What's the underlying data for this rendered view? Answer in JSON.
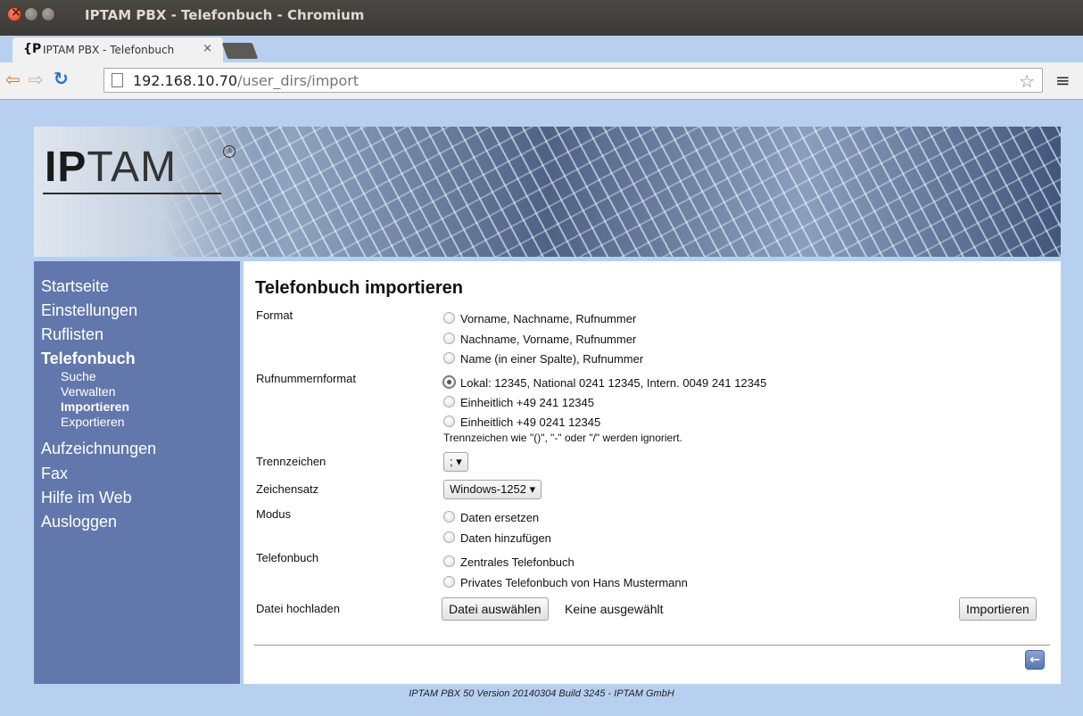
{
  "window": {
    "title": "IPTAM PBX - Telefonbuch - Chromium"
  },
  "tab": {
    "favicon": "{P",
    "title": "IPTAM PBX - Telefonbuch",
    "close": "×"
  },
  "toolbar": {
    "url_host": "192.168.10.70",
    "url_path": "/user_dirs/import"
  },
  "banner": {
    "logo_bold": "IP",
    "logo_light": "TAM",
    "logo_mark": "®"
  },
  "sidebar": {
    "items": [
      {
        "label": "Startseite"
      },
      {
        "label": "Einstellungen"
      },
      {
        "label": "Ruflisten"
      },
      {
        "label": "Telefonbuch"
      },
      {
        "label": "Aufzeichnungen"
      },
      {
        "label": "Fax"
      },
      {
        "label": "Hilfe im Web"
      },
      {
        "label": "Ausloggen"
      }
    ],
    "sub_items": [
      {
        "label": "Suche"
      },
      {
        "label": "Verwalten"
      },
      {
        "label": "Importieren"
      },
      {
        "label": "Exportieren"
      }
    ]
  },
  "form": {
    "title": "Telefonbuch importieren",
    "format": {
      "label": "Format",
      "options": [
        "Vorname, Nachname, Rufnummer",
        "Nachname, Vorname, Rufnummer",
        "Name (in einer Spalte), Rufnummer"
      ]
    },
    "number_format": {
      "label": "Rufnummernformat",
      "options": [
        "Lokal: 12345, National 0241 12345, Intern. 0049 241 12345",
        "Einheitlich +49 241 12345",
        "Einheitlich +49 0241 12345"
      ],
      "selected": 0,
      "hint": "Trennzeichen wie \"()\", \"-\" oder \"/\" werden ignoriert."
    },
    "separator": {
      "label": "Trennzeichen",
      "value": ";"
    },
    "charset": {
      "label": "Zeichensatz",
      "value": "Windows-1252"
    },
    "mode": {
      "label": "Modus",
      "options": [
        "Daten ersetzen",
        "Daten hinzufügen"
      ]
    },
    "phonebook": {
      "label": "Telefonbuch",
      "options": [
        "Zentrales Telefonbuch",
        "Privates Telefonbuch von Hans Mustermann"
      ]
    },
    "upload": {
      "label": "Datei hochladen",
      "button": "Datei auswählen",
      "status": "Keine ausgewählt"
    },
    "submit": "Importieren"
  },
  "footer": {
    "text": "IPTAM PBX 50 Version 20140304 Build 3245 - IPTAM GmbH"
  }
}
